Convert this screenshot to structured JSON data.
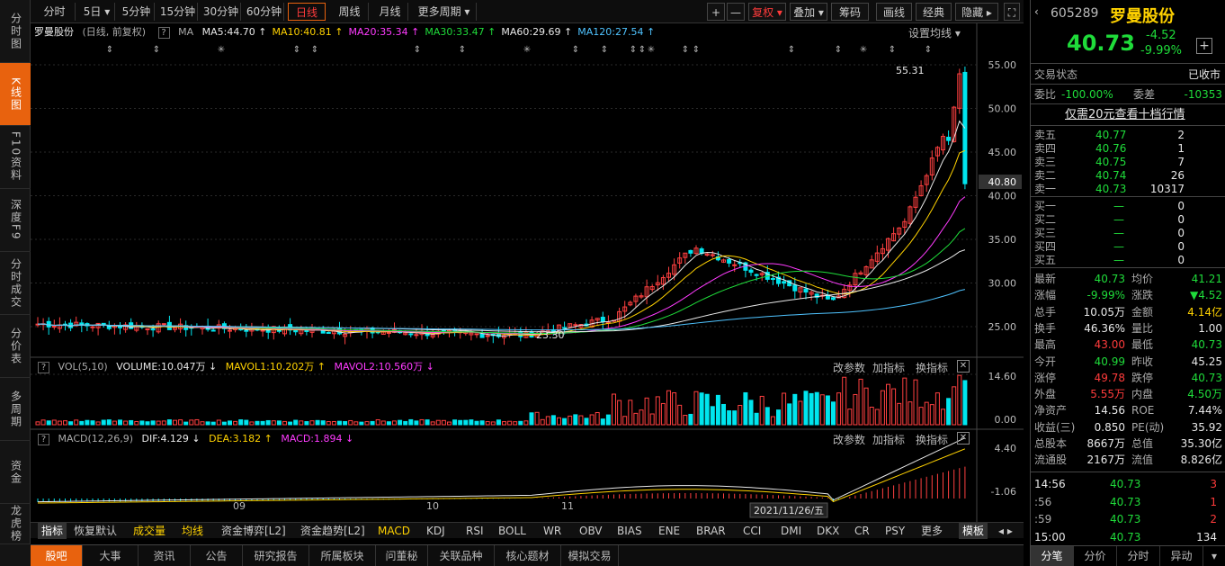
{
  "left_nav": [
    {
      "label": "分时图",
      "active": false
    },
    {
      "label": "K线图",
      "active": true
    },
    {
      "label": "F10资料",
      "active": false
    },
    {
      "label": "深度F9",
      "active": false
    },
    {
      "label": "分时成交",
      "active": false
    },
    {
      "label": "分价表",
      "active": false
    },
    {
      "label": "多周期",
      "active": false
    },
    {
      "label": "资金",
      "active": false
    },
    {
      "label": "龙虎榜",
      "active": false
    }
  ],
  "toolbar": {
    "periods": [
      "分时",
      "5日 ▾",
      "5分钟",
      "15分钟",
      "30分钟",
      "60分钟",
      "日线",
      "周线",
      "月线",
      "更多周期 ▾"
    ],
    "active_period": "日线",
    "right_buttons": [
      "+",
      "—",
      "复权 ▾",
      "叠加 ▾",
      "筹码",
      "画线",
      "经典",
      "隐藏 ▸"
    ],
    "fuquan": "复权 ▾"
  },
  "kline": {
    "stock_name": "罗曼股份",
    "mode": "(日线, 前复权)",
    "ma_label": "MA",
    "ma": [
      {
        "label": "MA5:44.70 ↑",
        "color": "#e8e8e8"
      },
      {
        "label": "MA10:40.81 ↑",
        "color": "#ffd200"
      },
      {
        "label": "MA20:35.34 ↑",
        "color": "#ff3bff"
      },
      {
        "label": "MA30:33.47 ↑",
        "color": "#1fdc3a"
      },
      {
        "label": "MA60:29.69 ↑",
        "color": "#e8e8e8"
      },
      {
        "label": "MA120:27.54 ↑",
        "color": "#4fc3ff"
      }
    ],
    "settings": "设置均线 ▾",
    "price_axis": [
      "55.00",
      "50.00",
      "45.00",
      "40.00",
      "35.00",
      "30.00",
      "25.00"
    ],
    "current_price_tag": "40.80",
    "high_label": "55.31",
    "low_label": "23.30"
  },
  "volume": {
    "title": "VOL(5,10)",
    "volume": "VOLUME:10.047万 ↓",
    "mavol1": "MAVOL1:10.202万 ↑",
    "mavol2": "MAVOL2:10.560万 ↓",
    "axis": [
      "14.60",
      "0.00"
    ],
    "ctrls": [
      "改参数",
      "加指标",
      "换指标"
    ]
  },
  "macd": {
    "title": "MACD(12,26,9)",
    "dif": "DIF:4.129 ↓",
    "dea": "DEA:3.182 ↑",
    "macd": "MACD:1.894 ↓",
    "axis": [
      "4.40",
      "-1.06"
    ],
    "ctrls": [
      "改参数",
      "加指标",
      "换指标"
    ],
    "x_labels": [
      "09",
      "10",
      "11"
    ],
    "cursor_date": "2021/11/26/五"
  },
  "indicator_bar": [
    "指标",
    "恢复默认",
    "成交量",
    "均线",
    "资金博弈[L2]",
    "资金趋势[L2]",
    "MACD",
    "KDJ",
    "RSI",
    "BOLL",
    "WR",
    "OBV",
    "BIAS",
    "ENE",
    "BRAR",
    "CCI",
    "DMI",
    "DKX",
    "CR",
    "PSY",
    "更多",
    "模板"
  ],
  "bottom_nav": [
    "股吧",
    "大事",
    "资讯",
    "公告",
    "研究报告",
    "所属板块",
    "问董秘",
    "关联品种",
    "核心题材",
    "模拟交易"
  ],
  "right_panel": {
    "code": "605289",
    "name": "罗曼股份",
    "price": "40.73",
    "change": "-4.52",
    "change_pct": "-9.99%",
    "status_label": "交易状态",
    "status": "已收市",
    "weibi_label": "委比",
    "weibi": "-100.00%",
    "weicha_label": "委差",
    "weicha": "-10353",
    "promo": "仅需20元查看十档行情",
    "asks": [
      {
        "label": "卖五",
        "price": "40.77",
        "vol": "2"
      },
      {
        "label": "卖四",
        "price": "40.76",
        "vol": "1"
      },
      {
        "label": "卖三",
        "price": "40.75",
        "vol": "7"
      },
      {
        "label": "卖二",
        "price": "40.74",
        "vol": "26"
      },
      {
        "label": "卖一",
        "price": "40.73",
        "vol": "10317"
      }
    ],
    "bids": [
      {
        "label": "买一",
        "price": "—",
        "vol": "0"
      },
      {
        "label": "买二",
        "price": "—",
        "vol": "0"
      },
      {
        "label": "买三",
        "price": "—",
        "vol": "0"
      },
      {
        "label": "买四",
        "price": "—",
        "vol": "0"
      },
      {
        "label": "买五",
        "price": "—",
        "vol": "0"
      }
    ],
    "stats": [
      {
        "l1": "最新",
        "v1": "40.73",
        "c1": "green",
        "l2": "均价",
        "v2": "41.21",
        "c2": "green"
      },
      {
        "l1": "涨幅",
        "v1": "-9.99%",
        "c1": "green",
        "l2": "涨跌",
        "v2": "▼4.52",
        "c2": "green"
      },
      {
        "l1": "总手",
        "v1": "10.05万",
        "c1": "white",
        "l2": "金额",
        "v2": "4.14亿",
        "c2": "yellow"
      },
      {
        "l1": "换手",
        "v1": "46.36%",
        "c1": "white",
        "l2": "量比",
        "v2": "1.00",
        "c2": "white"
      },
      {
        "l1": "最高",
        "v1": "43.00",
        "c1": "red",
        "l2": "最低",
        "v2": "40.73",
        "c2": "green"
      },
      {
        "l1": "今开",
        "v1": "40.99",
        "c1": "green",
        "l2": "昨收",
        "v2": "45.25",
        "c2": "white"
      },
      {
        "l1": "涨停",
        "v1": "49.78",
        "c1": "red",
        "l2": "跌停",
        "v2": "40.73",
        "c2": "green"
      },
      {
        "l1": "外盘",
        "v1": "5.55万",
        "c1": "red",
        "l2": "内盘",
        "v2": "4.50万",
        "c2": "green"
      },
      {
        "l1": "净资产",
        "v1": "14.56",
        "c1": "white",
        "l2": "ROE",
        "v2": "7.44%",
        "c2": "white"
      },
      {
        "l1": "收益(三)",
        "v1": "0.850",
        "c1": "white",
        "l2": "PE(动)",
        "v2": "35.92",
        "c2": "white"
      },
      {
        "l1": "总股本",
        "v1": "8667万",
        "c1": "white",
        "l2": "总值",
        "v2": "35.30亿",
        "c2": "white"
      },
      {
        "l1": "流通股",
        "v1": "2167万",
        "c1": "white",
        "l2": "流值",
        "v2": "8.826亿",
        "c2": "white"
      }
    ],
    "ticks": [
      {
        "time": "14:56",
        "price": "40.73",
        "vol": "3"
      },
      {
        "time": ":56",
        "price": "40.73",
        "vol": "1"
      },
      {
        "time": ":59",
        "price": "40.73",
        "vol": "2"
      },
      {
        "time": "15:00",
        "price": "40.73",
        "vol": "134"
      }
    ],
    "tabs": [
      "分笔",
      "分价",
      "分时",
      "异动"
    ]
  }
}
